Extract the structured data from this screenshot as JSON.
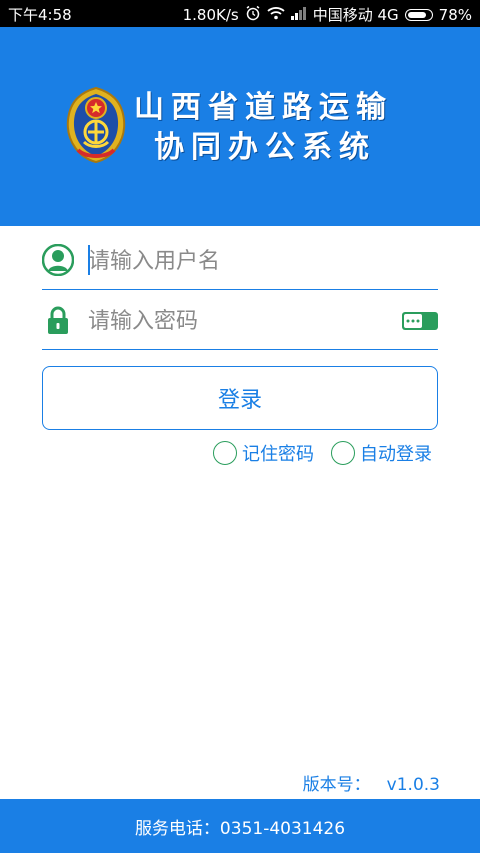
{
  "status_bar": {
    "time": "下午4:58",
    "speed": "1.80K/s",
    "carrier": "中国移动 4G",
    "battery": "78%",
    "battery_level": 0.78
  },
  "header": {
    "title_line1": "山西省道路运输",
    "title_line2": "协同办公系统",
    "emblem_icon": "transport-emblem",
    "background_color": "#1a7fe5"
  },
  "login_form": {
    "username_placeholder": "请输入用户名",
    "username_value": "",
    "password_placeholder": "请输入密码",
    "password_value": "",
    "login_label": "登录",
    "remember_label": "记住密码",
    "remember_checked": false,
    "auto_login_label": "自动登录",
    "auto_login_checked": false
  },
  "version": {
    "label": "版本号：",
    "value": "v1.0.3"
  },
  "footer": {
    "service_phone": "服务电话：0351-4031426"
  },
  "colors": {
    "accent": "#1a7fe5",
    "icon_green": "#2a9d5c"
  }
}
